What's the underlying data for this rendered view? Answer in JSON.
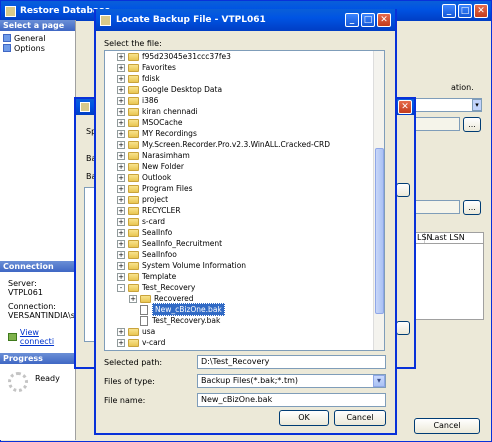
{
  "background_window": {
    "title": "Restore Database",
    "select_page_header": "Select a page",
    "pages": [
      "General",
      "Options"
    ],
    "connection_header": "Connection",
    "server_label": "Server:",
    "server_value": "VTPL061",
    "connection_label": "Connection:",
    "connection_value": "VERSANTINDIA\\sr",
    "view_connection_link": "View connecti",
    "progress_header": "Progress",
    "progress_status": "Ready",
    "info_fragment": "ation.",
    "col_lsn": "LSN",
    "col_last_lsn": "Last LSN",
    "cancel_label": "Cancel",
    "ellipsis": "...",
    "sp_fragment": "Sp",
    "ba_fragment": "Ba",
    "ba2_fragment": "Ba"
  },
  "locate_dialog": {
    "title": "Locate Backup File - VTPL061",
    "select_file_label": "Select the file:",
    "tree": [
      {
        "label": "f95d23045e31ccc37fe3",
        "expander": "+",
        "type": "folder",
        "level": 1
      },
      {
        "label": "Favorites",
        "expander": "+",
        "type": "folder",
        "level": 1
      },
      {
        "label": "fdisk",
        "expander": "+",
        "type": "folder",
        "level": 1
      },
      {
        "label": "Google Desktop Data",
        "expander": "+",
        "type": "folder",
        "level": 1
      },
      {
        "label": "i386",
        "expander": "+",
        "type": "folder",
        "level": 1
      },
      {
        "label": "kiran chennadi",
        "expander": "+",
        "type": "folder",
        "level": 1
      },
      {
        "label": "MSOCache",
        "expander": "+",
        "type": "folder",
        "level": 1
      },
      {
        "label": "MY Recordings",
        "expander": "+",
        "type": "folder",
        "level": 1
      },
      {
        "label": "My.Screen.Recorder.Pro.v2.3.WinALL.Cracked-CRD",
        "expander": "+",
        "type": "folder",
        "level": 1
      },
      {
        "label": "Narasimham",
        "expander": "+",
        "type": "folder",
        "level": 1
      },
      {
        "label": "New Folder",
        "expander": "+",
        "type": "folder",
        "level": 1
      },
      {
        "label": "Outlook",
        "expander": "+",
        "type": "folder",
        "level": 1
      },
      {
        "label": "Program Files",
        "expander": "+",
        "type": "folder",
        "level": 1
      },
      {
        "label": "project",
        "expander": "+",
        "type": "folder",
        "level": 1
      },
      {
        "label": "RECYCLER",
        "expander": "+",
        "type": "folder",
        "level": 1
      },
      {
        "label": "s-card",
        "expander": "+",
        "type": "folder",
        "level": 1
      },
      {
        "label": "SealInfo",
        "expander": "+",
        "type": "folder",
        "level": 1
      },
      {
        "label": "SealInfo_Recruitment",
        "expander": "+",
        "type": "folder",
        "level": 1
      },
      {
        "label": "SealInfoo",
        "expander": "+",
        "type": "folder",
        "level": 1
      },
      {
        "label": "System Volume Information",
        "expander": "+",
        "type": "folder",
        "level": 1
      },
      {
        "label": "Template",
        "expander": "+",
        "type": "folder",
        "level": 1
      },
      {
        "label": "Test_Recovery",
        "expander": "-",
        "type": "folder",
        "level": 1
      },
      {
        "label": "Recovered",
        "expander": "+",
        "type": "folder",
        "level": 2
      },
      {
        "label": "New_cBizOne.bak",
        "expander": "",
        "type": "file",
        "level": 2,
        "selected": true
      },
      {
        "label": "Test_Recovery.bak",
        "expander": "",
        "type": "file",
        "level": 2
      },
      {
        "label": "usa",
        "expander": "+",
        "type": "folder",
        "level": 1
      },
      {
        "label": "v-card",
        "expander": "+",
        "type": "folder",
        "level": 1
      }
    ],
    "selected_path_label": "Selected path:",
    "selected_path_value": "D:\\Test_Recovery",
    "files_of_type_label": "Files of type:",
    "files_of_type_value": "Backup Files(*.bak;*.tm)",
    "file_name_label": "File name:",
    "file_name_value": "New_cBizOne.bak",
    "ok_label": "OK",
    "cancel_label": "Cancel"
  },
  "colors": {
    "title_blue": "#0054e3",
    "selection_blue": "#316ac5",
    "dialog_face": "#ece9d8"
  }
}
